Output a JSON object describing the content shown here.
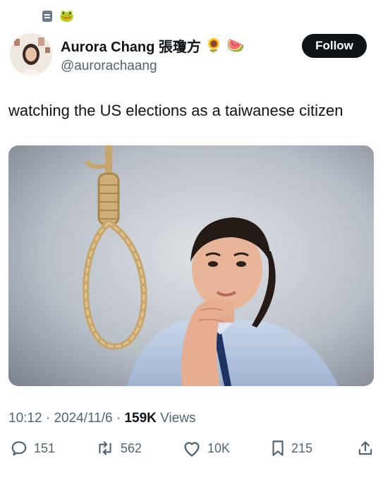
{
  "header_icons": [
    "doc-badge-icon",
    "frog-emoji"
  ],
  "author": {
    "display_name": "Aurora Chang 張瓊方",
    "handle": "@aurorachaang",
    "name_emojis": [
      "🌻",
      "🍉"
    ]
  },
  "follow_label": "Follow",
  "tweet": {
    "text": "watching the US elections as a taiwanese citizen"
  },
  "meta": {
    "time": "10:12",
    "sep1": "·",
    "date": "2024/11/6",
    "sep2": "·",
    "views_count": "159K",
    "views_label": "Views"
  },
  "actions": {
    "replies": "151",
    "reposts": "562",
    "likes": "10K",
    "bookmarks": "215"
  },
  "colors": {
    "text": "#0f1419",
    "secondary": "#536471",
    "follow_bg": "#0f1419"
  }
}
